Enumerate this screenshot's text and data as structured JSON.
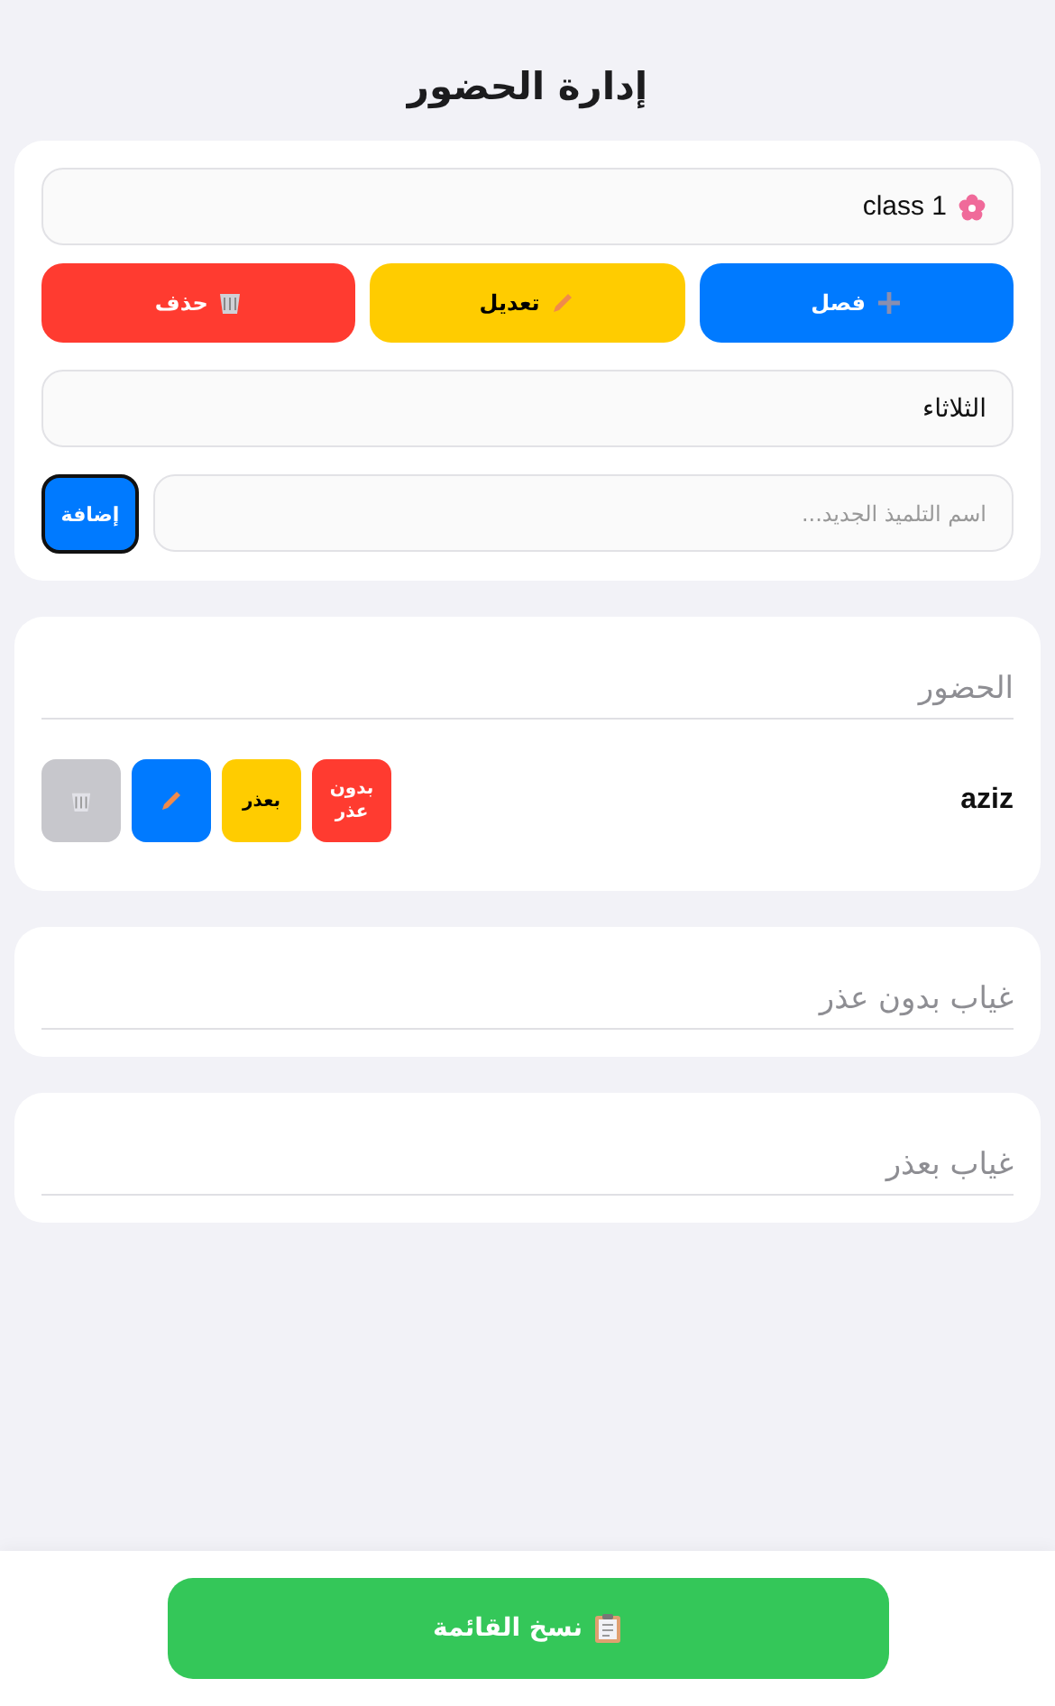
{
  "title": "إدارة الحضور",
  "class_select": {
    "value": "class 1"
  },
  "class_buttons": [
    {
      "kind": "add",
      "label": "فصل"
    },
    {
      "kind": "edit",
      "label": "تعديل"
    },
    {
      "kind": "delete",
      "label": "حذف"
    }
  ],
  "day_select": {
    "value": "الثلاثاء"
  },
  "student_input": {
    "placeholder": "اسم التلميذ الجديد..."
  },
  "add_button": {
    "label": "إضافة"
  },
  "sections": [
    {
      "title": "الحضور",
      "students": [
        {
          "name": "aziz",
          "buttons": [
            {
              "kind": "unexcused",
              "label": "بدون عذر"
            },
            {
              "kind": "excused",
              "label": "بعذر"
            },
            {
              "kind": "edit"
            },
            {
              "kind": "delete"
            }
          ]
        }
      ]
    },
    {
      "title": "غياب بدون عذر"
    },
    {
      "title": "غياب بعذر"
    }
  ],
  "copy_button": {
    "label": "نسخ القائمة"
  }
}
